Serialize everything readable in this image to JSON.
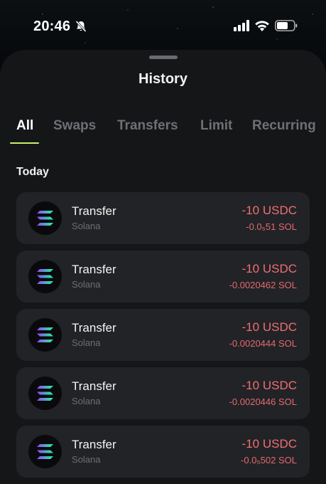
{
  "status_bar": {
    "time": "20:46",
    "icons": [
      "bell-slash-icon",
      "cellular-signal-icon",
      "wifi-icon",
      "battery-icon"
    ]
  },
  "sheet": {
    "title": "History"
  },
  "tabs": [
    {
      "label": "All",
      "active": true
    },
    {
      "label": "Swaps",
      "active": false
    },
    {
      "label": "Transfers",
      "active": false
    },
    {
      "label": "Limit",
      "active": false
    },
    {
      "label": "Recurring",
      "active": false
    }
  ],
  "accent_color": "#c6f26c",
  "negative_color": "#ef6f73",
  "section": {
    "label": "Today"
  },
  "transactions": [
    {
      "title": "Transfer",
      "network": "Solana",
      "amount": "-10 USDC",
      "sub_amount": "-0.0₅51 SOL",
      "icon": "solana-logo-icon"
    },
    {
      "title": "Transfer",
      "network": "Solana",
      "amount": "-10 USDC",
      "sub_amount": "-0.0020462 SOL",
      "icon": "solana-logo-icon"
    },
    {
      "title": "Transfer",
      "network": "Solana",
      "amount": "-10 USDC",
      "sub_amount": "-0.0020444 SOL",
      "icon": "solana-logo-icon"
    },
    {
      "title": "Transfer",
      "network": "Solana",
      "amount": "-10 USDC",
      "sub_amount": "-0.0020446 SOL",
      "icon": "solana-logo-icon"
    },
    {
      "title": "Transfer",
      "network": "Solana",
      "amount": "-10 USDC",
      "sub_amount": "-0.0₅502 SOL",
      "icon": "solana-logo-icon"
    }
  ]
}
